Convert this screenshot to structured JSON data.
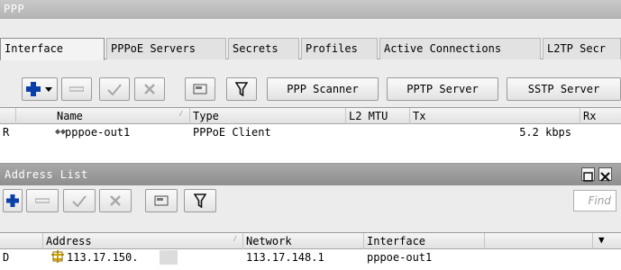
{
  "ppp": {
    "title": "PPP",
    "tabs": [
      "Interface",
      "PPPoE Servers",
      "Secrets",
      "Profiles",
      "Active Connections",
      "L2TP Secr"
    ],
    "toolbar": {
      "scanner_label": "PPP Scanner",
      "pptp_label": "PPTP Server",
      "sstp_label": "SSTP Server"
    },
    "columns": [
      "Name",
      "Type",
      "L2 MTU",
      "Tx",
      "Rx"
    ],
    "rows": [
      {
        "flag": "R",
        "name": "pppoe-out1",
        "type": "PPPoE Client",
        "l2mtu": "",
        "tx": "5.2 kbps",
        "rx": ""
      }
    ]
  },
  "address_list": {
    "title": "Address List",
    "find_placeholder": "Find",
    "columns": [
      "Address",
      "Network",
      "Interface"
    ],
    "rows": [
      {
        "flag": "D",
        "address": "113.17.150.",
        "network": "113.17.148.1",
        "interface": "pppoe-out1"
      }
    ]
  },
  "colors": {
    "add_icon": "#0b3fa8",
    "title_bar": "#b8b8b8",
    "address_icon": "#c9a000"
  }
}
